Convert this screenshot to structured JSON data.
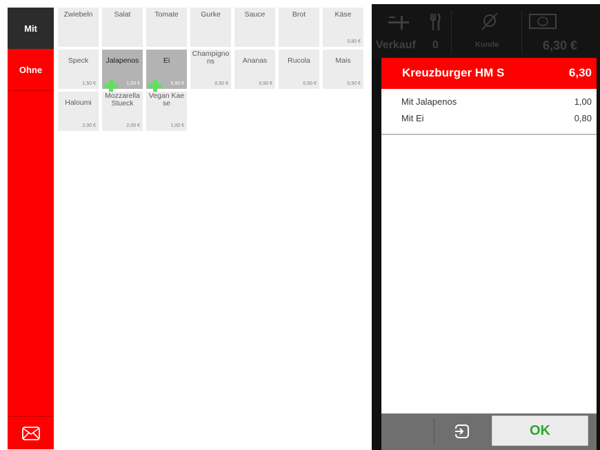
{
  "sidebar": {
    "mit_label": "Mit",
    "ohne_label": "Ohne"
  },
  "tiles": [
    {
      "name": "Zwiebeln",
      "price": ""
    },
    {
      "name": "Salat",
      "price": ""
    },
    {
      "name": "Tomate",
      "price": ""
    },
    {
      "name": "Gurke",
      "price": ""
    },
    {
      "name": "Sauce",
      "price": ""
    },
    {
      "name": "Brot",
      "price": ""
    },
    {
      "name": "Käse",
      "price": "0,80 €"
    },
    {
      "name": "Speck",
      "price": "1,50 €"
    },
    {
      "name": "Jalapenos",
      "price": "1,00 €"
    },
    {
      "name": "Ei",
      "price": "0,80 €"
    },
    {
      "name": "Champignons",
      "price": "0,50 €"
    },
    {
      "name": "Ananas",
      "price": "0,50 €"
    },
    {
      "name": "Rucola",
      "price": "0,50 €"
    },
    {
      "name": "Mais",
      "price": "0,50 €"
    },
    {
      "name": "Haloumi",
      "price": "2,00 €"
    },
    {
      "name": "Mozzarella Stueck",
      "price": "2,00 €"
    },
    {
      "name": "Vegan Kaese",
      "price": "1,00 €"
    }
  ],
  "topbar": {
    "verkauf_label": "Verkauf",
    "count": "0",
    "kunde_label": "Kunde",
    "total": "6,30 €"
  },
  "order": {
    "title": "Kreuzburger HM S",
    "price": "6,30",
    "lines": [
      {
        "name": "Mit Jalapenos",
        "value": "1,00"
      },
      {
        "name": "Mit Ei",
        "value": "0,80"
      }
    ]
  },
  "bottom": {
    "ok_label": "OK"
  },
  "colors": {
    "accent_red": "#ff0000",
    "ok_green": "#2ea82e",
    "plus_green": "#5fe05f"
  }
}
